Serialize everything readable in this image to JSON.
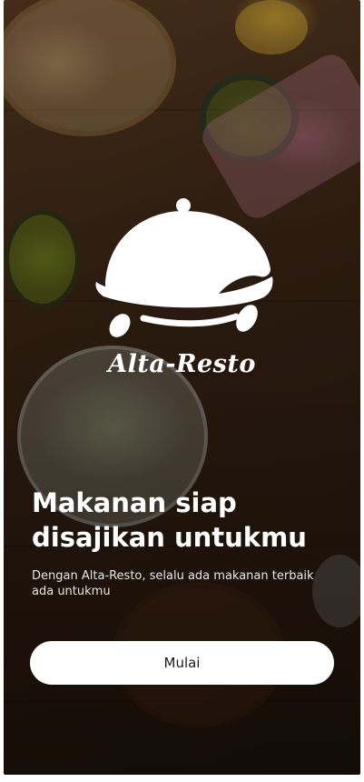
{
  "app": {
    "brand_name": "Alta-Resto",
    "logo_icon": "cloche-icon"
  },
  "hero": {
    "headline": "Makanan siap disajikan untukmu",
    "subtext": "Dengan Alta-Resto, selalu ada makanan terbaik ada untukmu"
  },
  "actions": {
    "start_label": "Mulai"
  },
  "colors": {
    "overlay": "#000000",
    "text": "#ffffff",
    "button_bg": "#ffffff",
    "button_text": "#1a1a1a"
  }
}
